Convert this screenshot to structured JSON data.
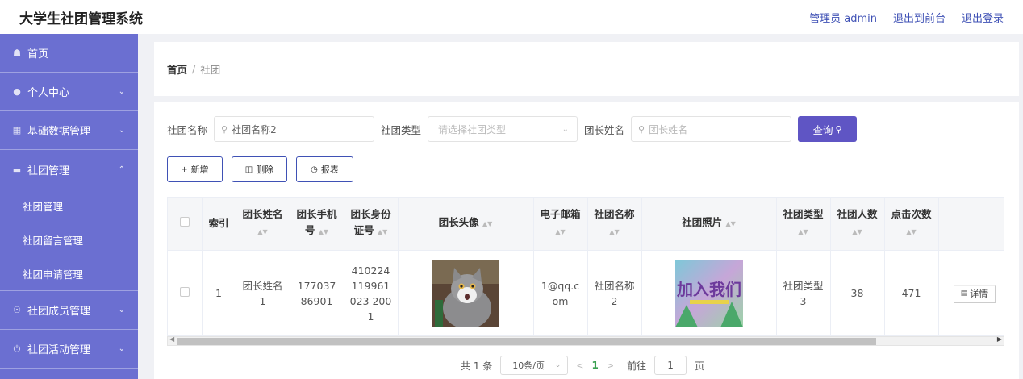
{
  "app": {
    "title": "大学生社团管理系统"
  },
  "header": {
    "admin_label": "管理员 admin",
    "back_label": "退出到前台",
    "logout_label": "退出登录"
  },
  "sidebar": {
    "items": [
      {
        "label": "首页",
        "icon": "home-icon"
      },
      {
        "label": "个人中心",
        "icon": "user-icon"
      },
      {
        "label": "基础数据管理",
        "icon": "ticket-icon"
      },
      {
        "label": "社团管理",
        "icon": "monitor-icon"
      },
      {
        "label": "社团成员管理",
        "icon": "compass-icon"
      },
      {
        "label": "社团活动管理",
        "icon": "power-icon"
      }
    ],
    "sub_items": [
      "社团管理",
      "社团留言管理",
      "社团申请管理"
    ]
  },
  "breadcrumb": {
    "home": "首页",
    "separator": "/",
    "current": "社团"
  },
  "search": {
    "name_label": "社团名称",
    "name_value": "社团名称2",
    "type_label": "社团类型",
    "type_placeholder": "请选择社团类型",
    "leader_label": "团长姓名",
    "leader_placeholder": "团长姓名",
    "query_label": "查询"
  },
  "actions": {
    "add": "新增",
    "delete": "删除",
    "report": "报表"
  },
  "table": {
    "headers": {
      "index": "索引",
      "leader_name": "团长姓名",
      "leader_phone": "团长手机号",
      "leader_id": "团长身份证号",
      "leader_avatar": "团长头像",
      "email": "电子邮箱",
      "club_name": "社团名称",
      "club_photo": "社团照片",
      "club_type": "社团类型",
      "member_count": "社团人数",
      "click_count": "点击次数"
    },
    "rows": [
      {
        "index": "1",
        "leader_name": "团长姓名1",
        "leader_phone": "17703786901",
        "leader_id": "410224119961023 2001",
        "email": "1@qq.com",
        "club_name": "社团名称2",
        "club_type": "社团类型3",
        "member_count": "38",
        "click_count": "471",
        "detail_label": "详情",
        "photo_text": "加入我们"
      }
    ]
  },
  "pagination": {
    "total": "共 1 条",
    "page_size": "10条/页",
    "current_page": "1",
    "goto_prefix": "前往",
    "goto_value": "1",
    "goto_suffix": "页"
  },
  "colors": {
    "sidebar": "#6b6fd1",
    "accent": "#3f51b5",
    "query_button": "#5f55c4"
  }
}
